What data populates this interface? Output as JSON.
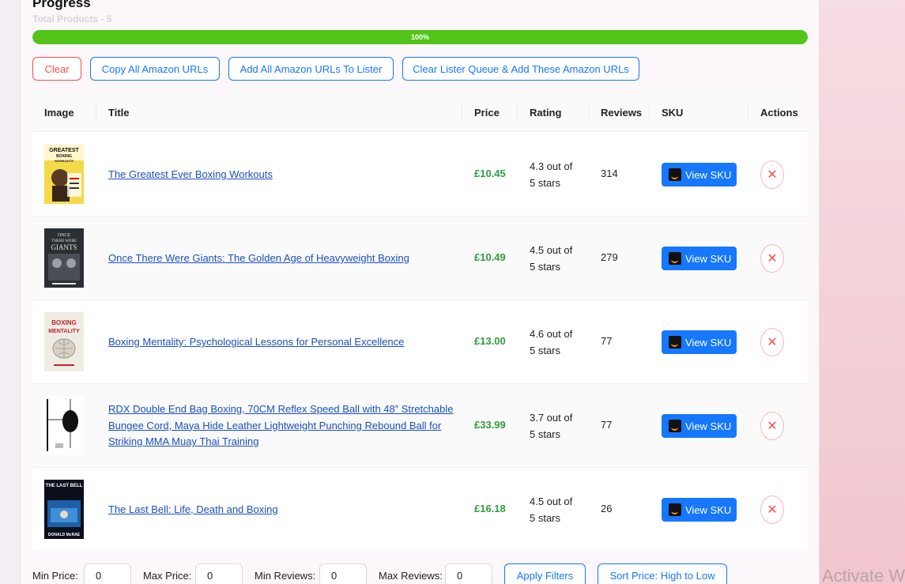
{
  "header": {
    "title": "Progress",
    "subtitle": "Total Products - 5",
    "progress_label": "100%",
    "progress_value": 1.0
  },
  "actions": {
    "clear": "Clear",
    "copy_all": "Copy All Amazon URLs",
    "add_all": "Add All Amazon URLs To Lister",
    "clear_queue": "Clear Lister Queue & Add These Amazon URLs"
  },
  "table": {
    "columns": [
      "Image",
      "Title",
      "Price",
      "Rating",
      "Reviews",
      "SKU",
      "Actions"
    ],
    "rows": [
      {
        "title": "The Greatest Ever Boxing Workouts",
        "price": "£10.45",
        "rating_line1": "4.3 out of",
        "rating_line2": "5 stars",
        "reviews": "314",
        "sku_label": "View SKU",
        "thumb": "book-greatest-boxing",
        "cover_text": [
          "GREATEST",
          "BOXING",
          "WORKOUTS"
        ]
      },
      {
        "title": "Once There Were Giants: The Golden Age of Heavyweight Boxing",
        "price": "£10.49",
        "rating_line1": "4.5 out of",
        "rating_line2": "5 stars",
        "reviews": "279",
        "sku_label": "View SKU",
        "thumb": "book-once-there-were-giants",
        "cover_text": [
          "ONCE",
          "THERE WERE",
          "GIANTS"
        ]
      },
      {
        "title": "Boxing Mentality: Psychological Lessons for Personal Excellence",
        "price": "£13.00",
        "rating_line1": "4.6 out of",
        "rating_line2": "5 stars",
        "reviews": "77",
        "sku_label": "View SKU",
        "thumb": "book-boxing-mentality",
        "cover_text": [
          "BOXING",
          "MENTALITY"
        ]
      },
      {
        "title": "RDX Double End Bag Boxing, 70CM Reflex Speed Ball with 48” Stretchable Bungee Cord, Maya Hide Leather Lightweight Punching Rebound Ball for Striking MMA Muay Thai Training",
        "price": "£33.99",
        "rating_line1": "3.7 out of",
        "rating_line2": "5 stars",
        "reviews": "77",
        "sku_label": "View SKU",
        "thumb": "product-speed-ball"
      },
      {
        "title": "The Last Bell: Life, Death and Boxing",
        "price": "£16.18",
        "rating_line1": "4.5 out of",
        "rating_line2": "5 stars",
        "reviews": "26",
        "sku_label": "View SKU",
        "thumb": "book-the-last-bell",
        "cover_text": [
          "THE LAST BELL",
          "DONALD McRAE"
        ]
      }
    ]
  },
  "filters": {
    "min_price_label": "Min Price:",
    "min_price_value": "0",
    "max_price_label": "Max Price:",
    "max_price_value": "0",
    "min_reviews_label": "Min Reviews:",
    "min_reviews_value": "0",
    "max_reviews_label": "Max Reviews:",
    "max_reviews_value": "0",
    "apply_label": "Apply Filters",
    "sort_label": "Sort Price: High to Low"
  },
  "watermark": "Activate W",
  "colors": {
    "primary": "#1677ff",
    "danger": "#ff4d4f",
    "success": "#52c41a",
    "price": "#2e9e3e"
  }
}
